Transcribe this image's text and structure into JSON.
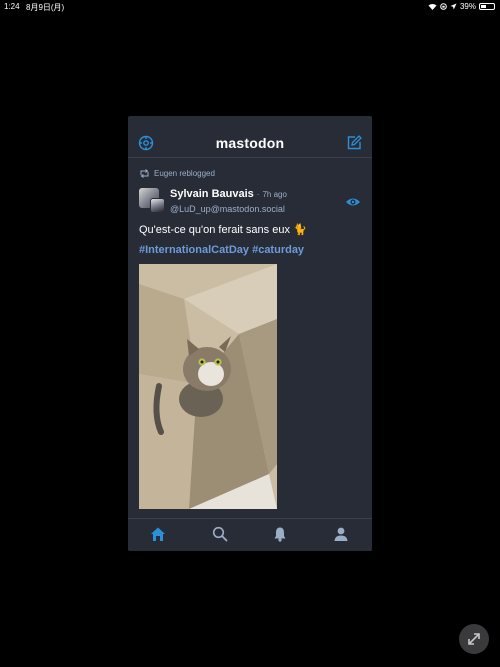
{
  "status_bar": {
    "time": "1:24",
    "date": "8月9日(月)",
    "battery": "39%",
    "icons": [
      "wifi-icon",
      "orientation-lock-icon",
      "location-icon",
      "battery-icon"
    ]
  },
  "app": {
    "logo": "mastodon",
    "icons": [
      "settings-icon",
      "compose-icon"
    ]
  },
  "status": {
    "reblog_text": "Eugen reblogged",
    "display_name": "Sylvain Bauvais",
    "separator": "·",
    "time_ago": "7h ago",
    "acct": "@LuD_up@mastodon.social",
    "content": "Qu'est-ce qu'on ferait sans eux 🐈",
    "hashtags": "#InternationalCatDay #caturday",
    "media_icon": "cat-photo",
    "visibility_icon": "eye-icon"
  },
  "nav": {
    "tabs": [
      "home-icon",
      "search-icon",
      "notifications-icon",
      "profile-icon"
    ],
    "active": "home-icon"
  },
  "colors": {
    "app_bg": "#282c37",
    "accent": "#2b90d9",
    "muted": "#9baec8",
    "hashtag": "#6d9bd9"
  }
}
